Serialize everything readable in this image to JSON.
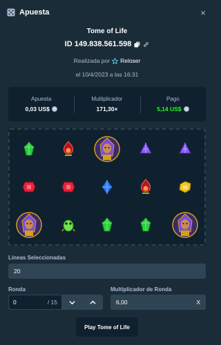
{
  "header": {
    "title": "Apuesta",
    "icon": "dice-icon",
    "close": "×"
  },
  "bet": {
    "game": "Tome of Life",
    "id": "ID 149.838.561.598",
    "made_by_label": "Realizada por",
    "user": "Reloser",
    "date": "el 10/4/2023 a las 16:31"
  },
  "stats": [
    {
      "label": "Apuesta",
      "value": "0,03 US$",
      "coin": true
    },
    {
      "label": "Multiplicador",
      "value": "171,30×",
      "coin": false
    },
    {
      "label": "Pago",
      "value": "5,14 US$",
      "coin": true
    }
  ],
  "board": {
    "rows": [
      [
        "green-gem",
        "red-fire-orb",
        "pharaoh-wild",
        "purple-gem",
        "purple-gem"
      ],
      [
        "red-gem",
        "red-gem",
        "blue-gem",
        "red-fire-orb",
        "yellow-gem"
      ],
      [
        "pharaoh-wild",
        "green-scarab",
        "green-gem",
        "green-gem",
        "pharaoh-wild"
      ]
    ]
  },
  "lines": {
    "label": "Líneas Seleccionadas",
    "value": "20"
  },
  "round": {
    "label": "Ronda",
    "value": "0",
    "total": "/ 15"
  },
  "round_multiplier": {
    "label": "Multiplicador de Ronda",
    "value": "6,00",
    "suffix": "X"
  },
  "play_button": "Play Tome of Life",
  "colors": {
    "background": "#1a2c38",
    "panel": "#0f212e",
    "input": "#2f4553",
    "payout": "#1fff20",
    "muted": "#b1bad3"
  }
}
